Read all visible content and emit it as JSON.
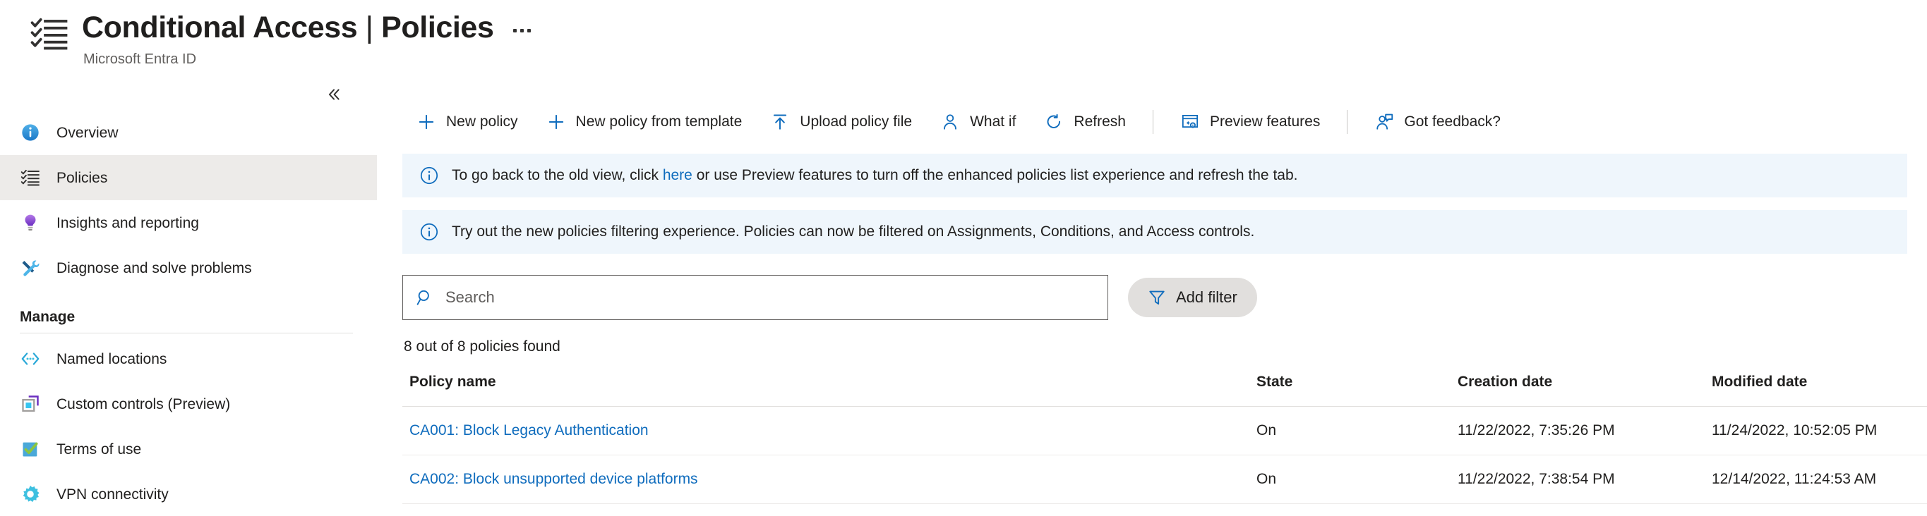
{
  "header": {
    "icon": "checklist-icon",
    "title_main": "Conditional Access",
    "title_separator": "|",
    "title_section": "Policies",
    "subtitle": "Microsoft Entra ID",
    "more_label": "More commands"
  },
  "sidebar": {
    "collapse_label": "Collapse",
    "items": [
      {
        "label": "Overview",
        "icon": "info-circle-icon",
        "selected": false
      },
      {
        "label": "Policies",
        "icon": "checklist-icon",
        "selected": true
      },
      {
        "label": "Insights and reporting",
        "icon": "lightbulb-icon",
        "selected": false
      },
      {
        "label": "Diagnose and solve problems",
        "icon": "tools-icon",
        "selected": false
      }
    ],
    "group_label": "Manage",
    "manage_items": [
      {
        "label": "Named locations",
        "icon": "code-brackets-icon"
      },
      {
        "label": "Custom controls (Preview)",
        "icon": "custom-controls-icon"
      },
      {
        "label": "Terms of use",
        "icon": "checkbox-checked-icon"
      },
      {
        "label": "VPN connectivity",
        "icon": "gear-icon"
      }
    ]
  },
  "toolbar": {
    "buttons": [
      {
        "label": "New policy",
        "icon": "plus-icon"
      },
      {
        "label": "New policy from template",
        "icon": "plus-icon"
      },
      {
        "label": "Upload policy file",
        "icon": "upload-icon"
      },
      {
        "label": "What if",
        "icon": "person-icon"
      },
      {
        "label": "Refresh",
        "icon": "refresh-icon"
      },
      {
        "label": "Preview features",
        "icon": "preview-features-icon"
      },
      {
        "label": "Got feedback?",
        "icon": "feedback-icon"
      }
    ]
  },
  "banners": [
    {
      "icon": "info-icon",
      "text_before": "To go back to the old view, click ",
      "link_text": "here",
      "text_after": " or use Preview features to turn off the enhanced policies list experience and refresh the tab."
    },
    {
      "icon": "info-icon",
      "text_before": "Try out the new policies filtering experience. Policies can now be filtered on Assignments, Conditions, and Access controls.",
      "link_text": "",
      "text_after": ""
    }
  ],
  "search": {
    "placeholder": "Search",
    "value": "",
    "icon": "search-icon"
  },
  "add_filter": {
    "label": "Add filter",
    "icon": "filter-icon"
  },
  "results": {
    "count_text": "8 out of 8 policies found"
  },
  "table": {
    "columns": [
      "Policy name",
      "State",
      "Creation date",
      "Modified date"
    ],
    "rows": [
      {
        "name": "CA001: Block Legacy Authentication",
        "state": "On",
        "creation_date": "11/22/2022, 7:35:26 PM",
        "modified_date": "11/24/2022, 10:52:05 PM"
      },
      {
        "name": "CA002: Block unsupported device platforms",
        "state": "On",
        "creation_date": "11/22/2022, 7:38:54 PM",
        "modified_date": "12/14/2022, 11:24:53 AM"
      }
    ]
  },
  "colors": {
    "accent": "#0f6cbd",
    "link": "#0f6cbd",
    "banner_bg": "#eff6fc",
    "selected_bg": "#edebe9"
  }
}
